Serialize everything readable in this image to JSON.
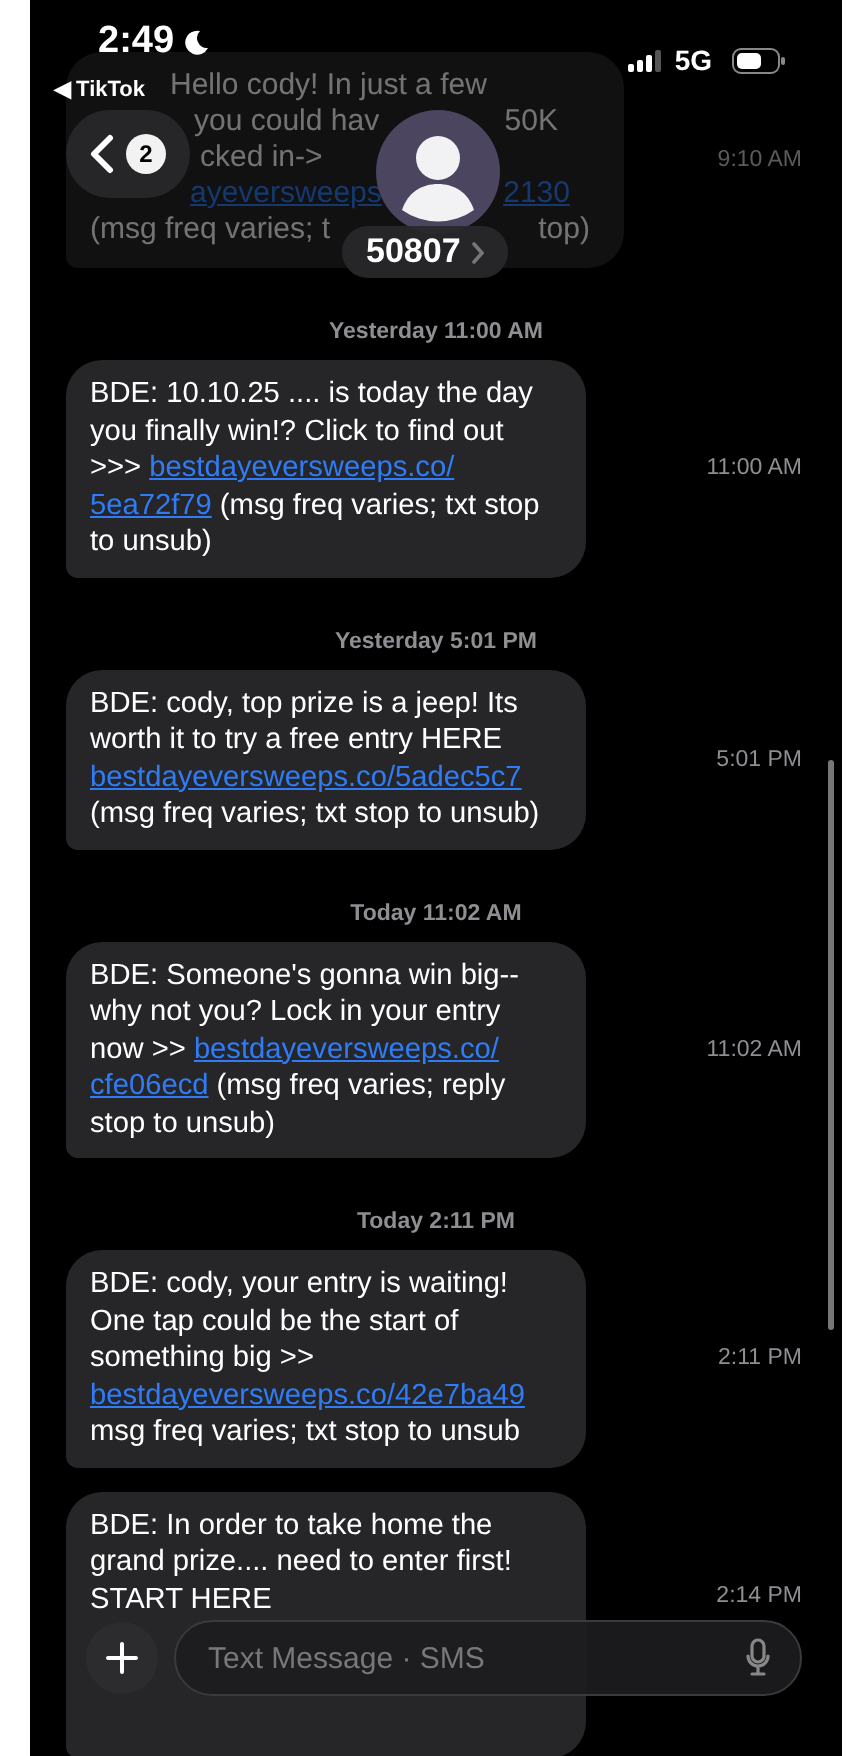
{
  "status_bar": {
    "time": "2:49",
    "back_app": "◀ TikTok",
    "network": "5G"
  },
  "header": {
    "back_badge": "2",
    "contact": "50807"
  },
  "faded_message": {
    "lines": [
      {
        "fragments": [
          {
            "text": "Hello cody! In just a few",
            "kind": "text"
          }
        ]
      },
      {
        "fragments": [
          {
            "text": "you could hav",
            "kind": "text"
          },
          {
            "text": "50K",
            "kind": "text"
          }
        ]
      },
      {
        "fragments": [
          {
            "text": "cked in->",
            "kind": "text"
          }
        ]
      },
      {
        "fragments": [
          {
            "text": "ayeversweeps",
            "kind": "link"
          },
          {
            "text": "2130",
            "kind": "link"
          }
        ]
      },
      {
        "fragments": [
          {
            "text": "(msg freq varies; t",
            "kind": "text"
          },
          {
            "text": "top)",
            "kind": "text"
          }
        ]
      }
    ],
    "time": "9:10 AM"
  },
  "messages": [
    {
      "timestamp": "Yesterday 11:00 AM",
      "time": "11:00 AM",
      "parts": [
        {
          "text": "BDE: 10.10.25 .... is today the day you finally win!? Click to find out >>> ",
          "kind": "text"
        },
        {
          "text": "bestdayeversweeps.co/",
          "kind": "link"
        },
        {
          "text": "5ea72f79",
          "kind": "link"
        },
        {
          "text": " (msg freq varies; txt stop to unsub)",
          "kind": "text"
        }
      ]
    },
    {
      "timestamp": "Yesterday 5:01 PM",
      "time": "5:01 PM",
      "parts": [
        {
          "text": "BDE: cody, top prize is a jeep! Its worth it to try a free entry HERE ",
          "kind": "text"
        },
        {
          "text": "bestdayeversweeps.co/5adec5c7",
          "kind": "link"
        },
        {
          "text": " (msg freq varies; txt stop to unsub)",
          "kind": "text"
        }
      ]
    },
    {
      "timestamp": "Today 11:02 AM",
      "time": "11:02 AM",
      "parts": [
        {
          "text": "BDE: Someone's gonna win big-- why not you? Lock in your entry now >> ",
          "kind": "text"
        },
        {
          "text": "bestdayeversweeps.co/",
          "kind": "link"
        },
        {
          "text": "cfe06ecd",
          "kind": "link"
        },
        {
          "text": " (msg freq varies; reply stop to unsub)",
          "kind": "text"
        }
      ]
    },
    {
      "timestamp": "Today 2:11 PM",
      "time": "2:11 PM",
      "parts": [
        {
          "text": "BDE: cody, your entry is waiting! One tap could be the start of something big >> ",
          "kind": "text"
        },
        {
          "text": "bestdayeversweeps.co/42e7ba49",
          "kind": "link"
        },
        {
          "text": " msg freq varies; txt stop to unsub",
          "kind": "text"
        }
      ]
    },
    {
      "time": "2:14 PM",
      "parts": [
        {
          "text": "BDE: In order to take home the grand prize.... need to enter first! START HERE",
          "kind": "text"
        }
      ]
    }
  ],
  "composer": {
    "placeholder": "Text Message · SMS"
  }
}
